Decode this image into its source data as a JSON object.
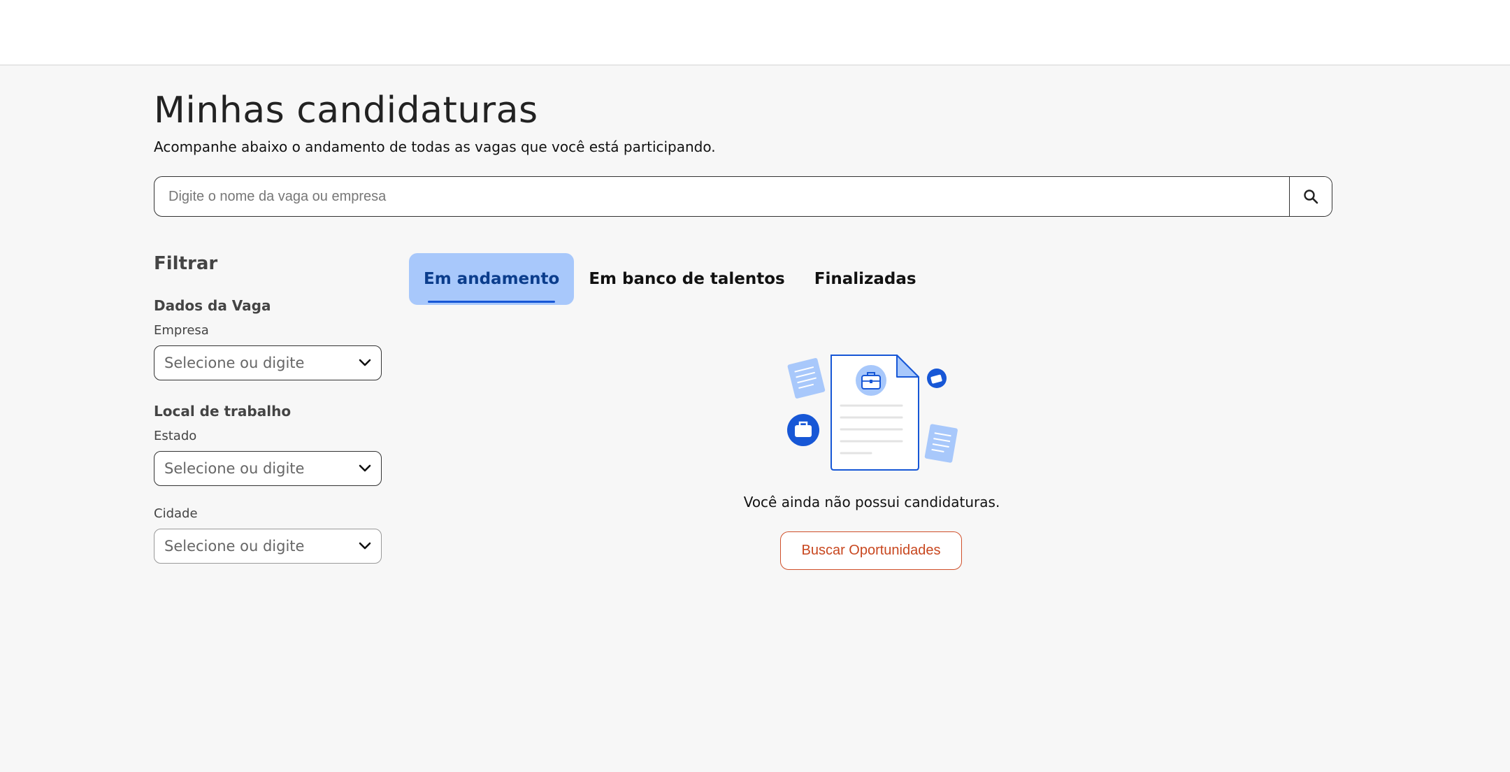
{
  "header": {
    "title": "Minhas candidaturas",
    "subtitle": "Acompanhe abaixo o andamento de todas as vagas que você está participando."
  },
  "search": {
    "placeholder": "Digite o nome da vaga ou empresa",
    "value": "",
    "button_icon": "search-icon"
  },
  "filters": {
    "title": "Filtrar",
    "sections": [
      {
        "title": "Dados da Vaga",
        "fields": [
          {
            "label": "Empresa",
            "placeholder": "Selecione ou digite",
            "icon": "chevron-down-icon"
          }
        ]
      },
      {
        "title": "Local de trabalho",
        "fields": [
          {
            "label": "Estado",
            "placeholder": "Selecione ou digite",
            "icon": "chevron-down-icon"
          },
          {
            "label": "Cidade",
            "placeholder": "Selecione ou digite",
            "icon": "chevron-down-icon"
          }
        ]
      }
    ]
  },
  "tabs": [
    {
      "label": "Em andamento",
      "active": true
    },
    {
      "label": "Em banco de talentos",
      "active": false
    },
    {
      "label": "Finalizadas",
      "active": false
    }
  ],
  "empty_state": {
    "illustration": "document-briefcase-illustration",
    "message": "Você ainda não possui candidaturas.",
    "button_label": "Buscar Oportunidades"
  },
  "colors": {
    "accent_blue": "#1757d6",
    "active_tab_bg": "#a8c8fb",
    "cta_orange": "#c8471f",
    "page_bg": "#f7f7f7"
  }
}
